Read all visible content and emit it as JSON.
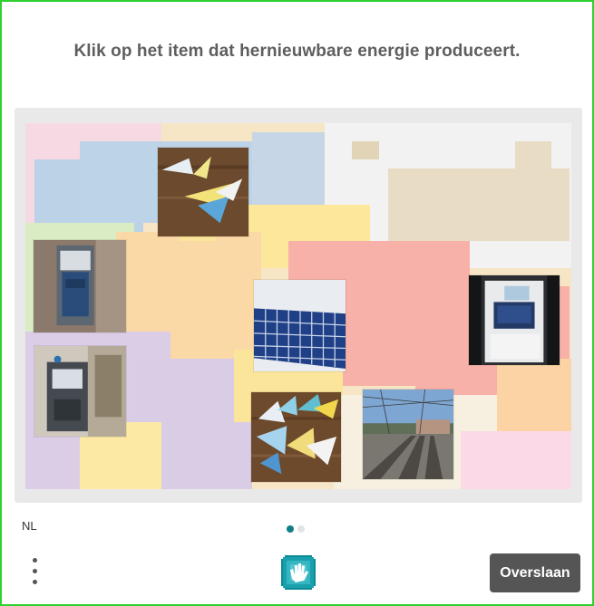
{
  "challenge": {
    "prompt": "Klik op het item dat hernieuwbare energie produceert."
  },
  "tiles": [
    {
      "subject": "origami-paper-boats",
      "selected": false
    },
    {
      "subject": "ticket-machine",
      "selected": false
    },
    {
      "subject": "ticket-machine",
      "selected": false
    },
    {
      "subject": "solar-panel",
      "selected": false
    },
    {
      "subject": "ticket-machine",
      "selected": false
    },
    {
      "subject": "origami-paper-boats",
      "selected": false
    },
    {
      "subject": "railway-tracks",
      "selected": false
    }
  ],
  "footer": {
    "language": "NL",
    "page_indicator": {
      "current": 1,
      "total": 2
    },
    "skip_label": "Overslaan",
    "menu_icon": "kebab-menu-icon",
    "logo_icon": "hand-logo-icon"
  },
  "colors": {
    "frame_border": "#2fd12f",
    "prompt_text": "#5e5e5e",
    "skip_button": "#555555",
    "active_dot": "#127e87"
  }
}
